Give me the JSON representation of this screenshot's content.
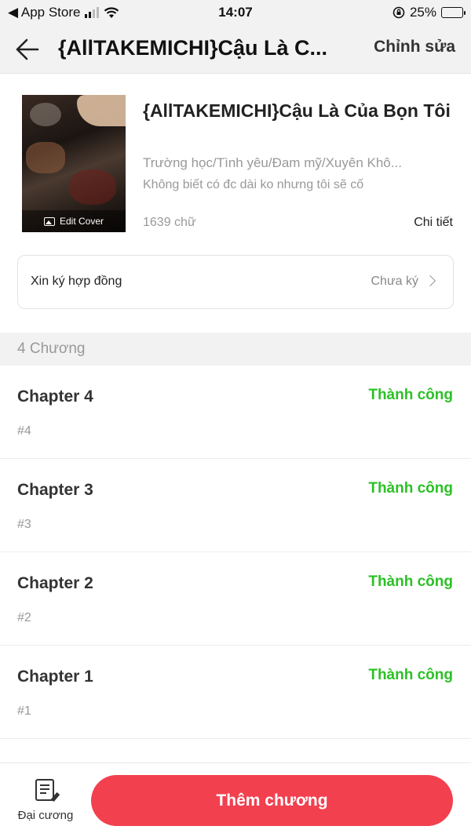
{
  "status_bar": {
    "back_app": "◀ App Store",
    "time": "14:07",
    "battery": "25%",
    "battery_level": 0.25,
    "icons": [
      "signal-icon",
      "wifi-icon",
      "rotation-lock-icon",
      "battery-icon"
    ]
  },
  "nav": {
    "back_icon": "arrow-left-icon",
    "title": "{AllTAKEMICHI}Cậu Là C...",
    "edit_label": "Chỉnh sửa"
  },
  "book": {
    "cover_label": "Edit Cover",
    "title": "{AllTAKEMICHI}Cậu Là Của Bọn Tôi",
    "genres": "Trường học/Tình yêu/Đam mỹ/Xuyên Khô...",
    "description": "Không biết có đc dài ko nhưng tôi sẽ cố",
    "word_count": "1639 chữ",
    "detail_label": "Chi tiết"
  },
  "contract": {
    "label": "Xin ký hợp đồng",
    "status": "Chưa ký"
  },
  "chapters_header": "4 Chương",
  "chapters": [
    {
      "title": "Chapter 4",
      "number": "#4",
      "status": "Thành công"
    },
    {
      "title": "Chapter 3",
      "number": "#3",
      "status": "Thành công"
    },
    {
      "title": "Chapter 2",
      "number": "#2",
      "status": "Thành công"
    },
    {
      "title": "Chapter 1",
      "number": "#1",
      "status": "Thành công"
    }
  ],
  "bottom": {
    "outline_label": "Đại cương",
    "add_chapter_label": "Thêm chương"
  },
  "colors": {
    "accent": "#f2404f",
    "success": "#2bc125"
  }
}
